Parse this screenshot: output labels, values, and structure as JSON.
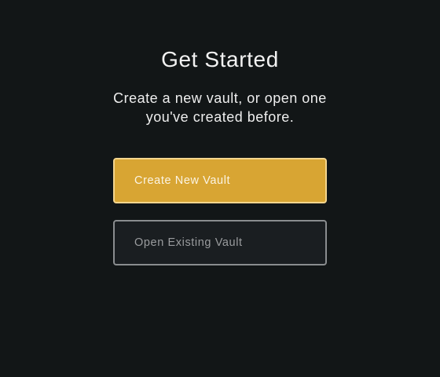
{
  "heading": {
    "title": "Get Started",
    "subtitle": "Create a new vault, or open one you've created before."
  },
  "actions": {
    "create_label": "Create New Vault",
    "open_label": "Open Existing Vault"
  },
  "colors": {
    "background": "#121617",
    "accent": "#d8a533",
    "accent_border": "#f4d58e",
    "secondary_bg": "#1a1e21",
    "secondary_border": "#8a8d8f"
  }
}
